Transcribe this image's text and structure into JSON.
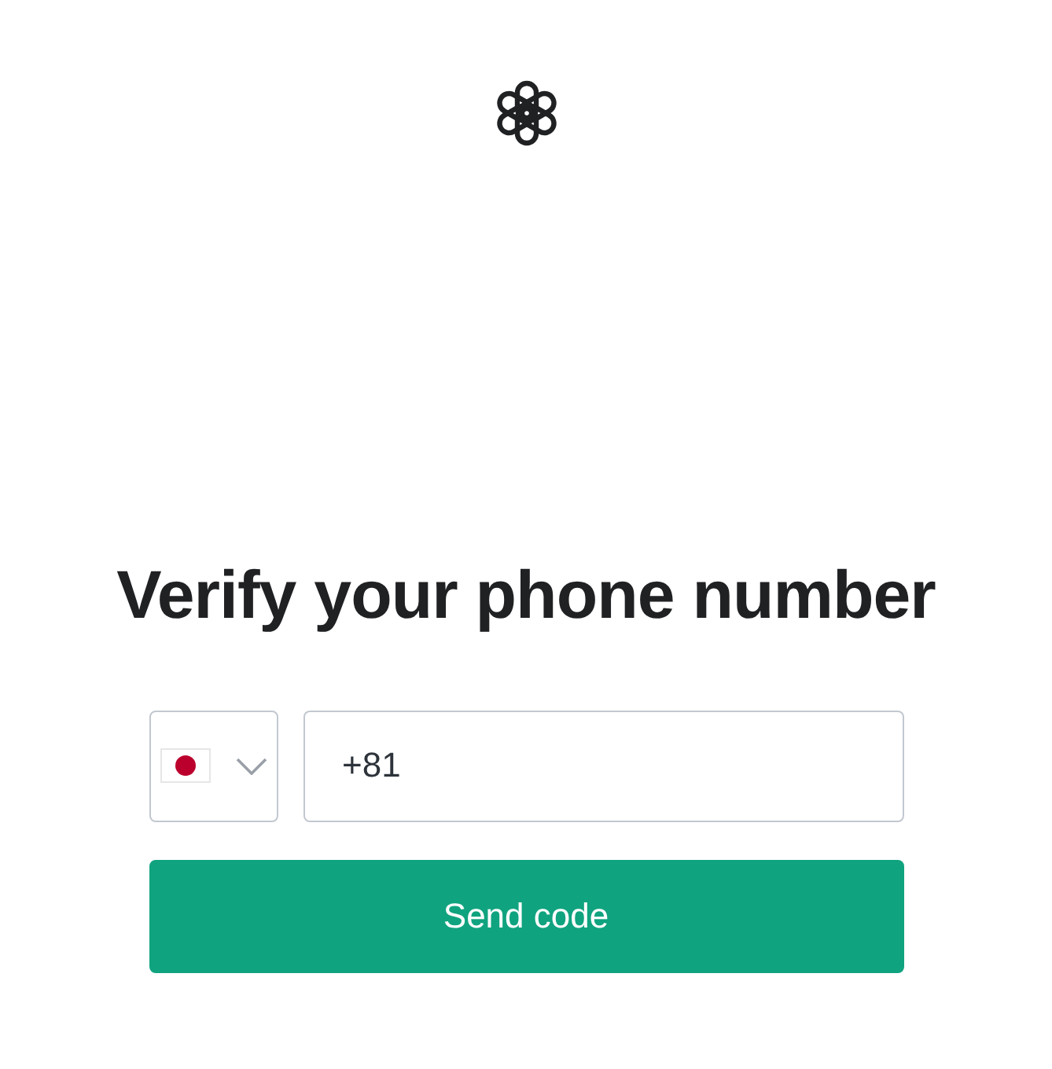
{
  "heading": "Verify your phone number",
  "phone_field": {
    "value": "+81"
  },
  "submit_button": {
    "label": "Send code"
  }
}
